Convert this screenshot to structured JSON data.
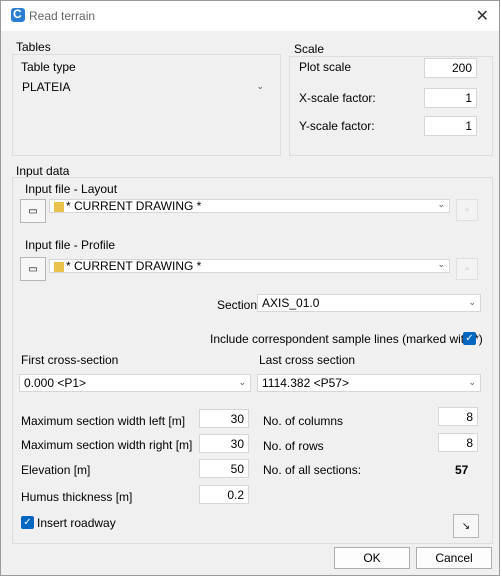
{
  "window": {
    "title": "Read terrain"
  },
  "tables": {
    "group_label": "Tables",
    "table_type_label": "Table type",
    "table_type_value": "PLATEIA"
  },
  "scale": {
    "group_label": "Scale",
    "plot_scale_label": "Plot scale",
    "plot_scale_value": "200",
    "xscale_label": "X-scale factor:",
    "xscale_value": "1",
    "yscale_label": "Y-scale factor:",
    "yscale_value": "1"
  },
  "input": {
    "group_label": "Input data",
    "layout_label": "Input file - Layout",
    "layout_value": "* CURRENT DRAWING *",
    "profile_label": "Input file - Profile",
    "profile_value": "* CURRENT DRAWING *",
    "section_label": "Section",
    "section_value": "AXIS_01.0",
    "include_label": "Include correspondent sample lines (marked with *)",
    "first_cross_label": "First cross-section",
    "first_cross_value": "0.000 <P1>",
    "last_cross_label": "Last cross section",
    "last_cross_value": "1114.382 <P57>",
    "max_left_label": "Maximum section width left [m]",
    "max_left_value": "30",
    "max_right_label": "Maximum section width right [m]",
    "max_right_value": "30",
    "elevation_label": "Elevation [m]",
    "elevation_value": "50",
    "humus_label": "Humus thickness [m]",
    "humus_value": "0.2",
    "columns_label": "No. of columns",
    "columns_value": "8",
    "rows_label": "No. of rows",
    "rows_value": "8",
    "all_sections_label": "No. of all sections:",
    "all_sections_value": "57",
    "roadway_label": "Insert roadway"
  },
  "buttons": {
    "ok": "OK",
    "cancel": "Cancel"
  }
}
